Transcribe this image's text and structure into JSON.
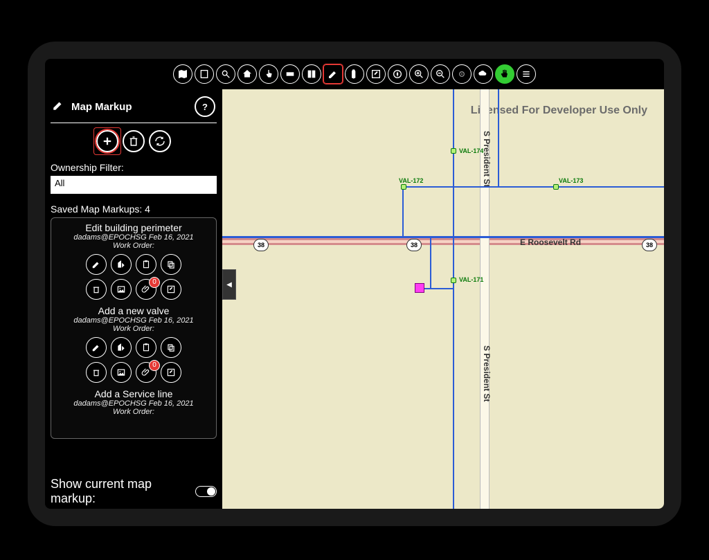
{
  "toolbar": {
    "items": [
      {
        "name": "maps-icon"
      },
      {
        "name": "document-icon"
      },
      {
        "name": "search-layer-icon"
      },
      {
        "name": "home-icon"
      },
      {
        "name": "touch-icon"
      },
      {
        "name": "layers-icon"
      },
      {
        "name": "bookmarks-icon"
      },
      {
        "name": "pencil-icon",
        "active": true
      },
      {
        "name": "marker-icon"
      },
      {
        "name": "edit-icon"
      },
      {
        "name": "compass-icon"
      },
      {
        "name": "zoom-in-icon"
      },
      {
        "name": "zoom-out-icon"
      },
      {
        "name": "locate-icon"
      },
      {
        "name": "cloud-icon"
      },
      {
        "name": "pan-icon",
        "green": true
      },
      {
        "name": "menu-icon"
      }
    ]
  },
  "panel": {
    "title": "Map Markup",
    "actions": {
      "add": {
        "name": "add-markup-button",
        "highlight": true
      },
      "delete": {
        "name": "delete-markup-button"
      },
      "refresh": {
        "name": "refresh-markup-button"
      }
    },
    "ownership_label": "Ownership Filter:",
    "ownership_value": "All",
    "saved_count_label": "Saved Map Markups: 4",
    "show_current_label": "Show current map markup:"
  },
  "markups": [
    {
      "title": "Edit building perimeter",
      "meta": "dadams@EPOCHSG  Feb 16, 2021",
      "work_order": "Work Order:",
      "badge": "0"
    },
    {
      "title": "Add a new valve",
      "meta": "dadams@EPOCHSG  Feb 16, 2021",
      "work_order": "Work Order:",
      "badge": "0"
    },
    {
      "title": "Add a Service line",
      "meta": "dadams@EPOCHSG  Feb 16, 2021",
      "work_order": "Work Order:"
    }
  ],
  "map": {
    "watermark": "Licensed For Developer Use Only",
    "roads": {
      "horizontal": "E Roosevelt Rd",
      "vertical": "S President St",
      "route_shield": "38"
    },
    "valves": [
      "VAL-174",
      "VAL-172",
      "VAL-173",
      "VAL-171"
    ]
  }
}
